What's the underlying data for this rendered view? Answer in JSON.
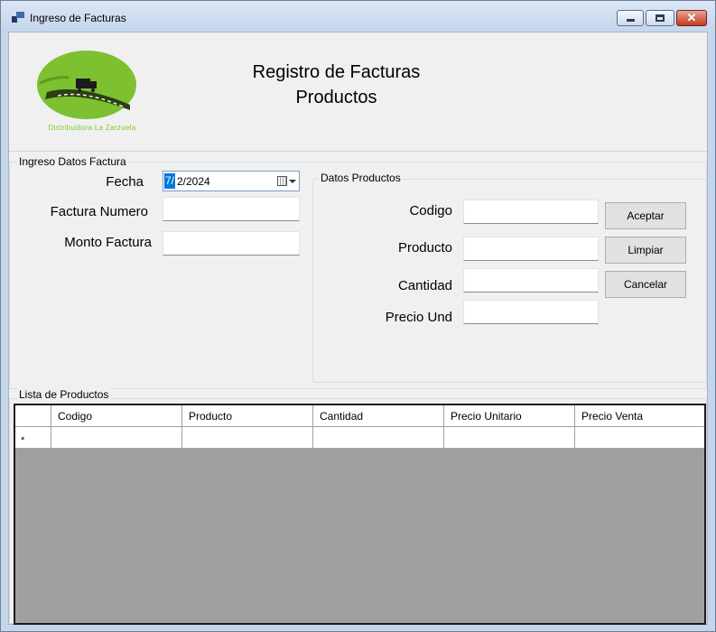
{
  "window": {
    "title": "Ingreso de Facturas",
    "close_glyph": "✕"
  },
  "logo": {
    "caption": "Distribuidora La Zarzuela",
    "colors": {
      "green": "#7dc030",
      "road": "#2b3f12",
      "truck": "#1c1c1c"
    }
  },
  "heading": {
    "line1": "Registro de Facturas",
    "line2": "Productos"
  },
  "invoice": {
    "group_title": "Ingreso Datos Factura",
    "fecha_label": "Fecha",
    "fecha_day": "7/",
    "fecha_rest": "2/2024",
    "numero_label": "Factura Numero",
    "numero_value": "",
    "monto_label": "Monto Factura",
    "monto_value": ""
  },
  "products": {
    "group_title": "Datos Productos",
    "codigo_label": "Codigo",
    "codigo_value": "",
    "producto_label": "Producto",
    "producto_value": "",
    "cantidad_label": "Cantidad",
    "cantidad_value": "",
    "precio_label": "Precio Und",
    "precio_value": "",
    "buttons": {
      "aceptar": "Aceptar",
      "limpiar": "Limpiar",
      "cancelar": "Cancelar"
    }
  },
  "list": {
    "group_title": "Lista de Productos",
    "columns": [
      "Codigo",
      "Producto",
      "Cantidad",
      "Precio Unitario",
      "Precio Venta"
    ],
    "new_row_marker": "*"
  },
  "colors": {
    "accent": "#0078d7",
    "grid_background": "#a0a0a0",
    "close_button": "#c43b22"
  }
}
